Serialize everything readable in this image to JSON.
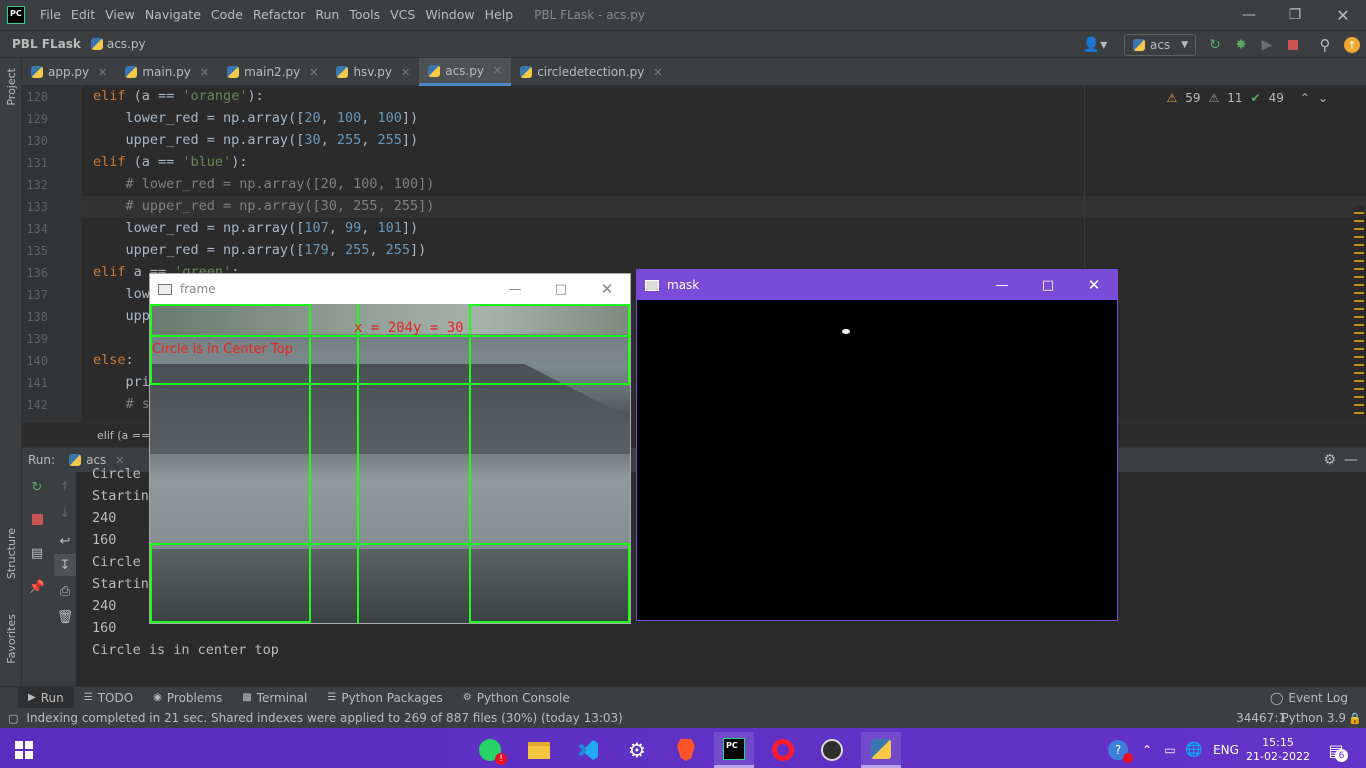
{
  "ide": {
    "menu": [
      "File",
      "Edit",
      "View",
      "Navigate",
      "Code",
      "Refactor",
      "Run",
      "Tools",
      "VCS",
      "Window",
      "Help"
    ],
    "window_title": "PBL FLask - acs.py",
    "project": "PBL FLask",
    "current_file": "acs.py",
    "run_config": "acs",
    "tabs": [
      {
        "label": "app.py"
      },
      {
        "label": "main.py"
      },
      {
        "label": "main2.py"
      },
      {
        "label": "hsv.py"
      },
      {
        "label": "acs.py",
        "active": true
      },
      {
        "label": "circledetection.py"
      }
    ],
    "inspections": {
      "warnings": "59",
      "weak_warnings": "11",
      "ok": "49"
    },
    "left_strip": {
      "project": "Project",
      "structure": "Structure",
      "favorites": "Favorites"
    },
    "code_lines": [
      {
        "n": "128",
        "text": "elif (a == 'orange'):"
      },
      {
        "n": "129",
        "text": "    lower_red = np.array([20, 100, 100])"
      },
      {
        "n": "130",
        "text": "    upper_red = np.array([30, 255, 255])"
      },
      {
        "n": "131",
        "text": "elif (a == 'blue'):"
      },
      {
        "n": "132",
        "text": "    # lower_red = np.array([20, 100, 100])"
      },
      {
        "n": "133",
        "text": "    # upper_red = np.array([30, 255, 255])"
      },
      {
        "n": "134",
        "text": "    lower_red = np.array([107, 99, 101])"
      },
      {
        "n": "135",
        "text": "    upper_red = np.array([179, 255, 255])"
      },
      {
        "n": "136",
        "text": "elif a == 'green':"
      },
      {
        "n": "137",
        "text": "    lower_red"
      },
      {
        "n": "138",
        "text": "    upper_red"
      },
      {
        "n": "139",
        "text": ""
      },
      {
        "n": "140",
        "text": "else:"
      },
      {
        "n": "141",
        "text": "    print"
      },
      {
        "n": "142",
        "text": "    # s"
      }
    ],
    "breadcrumb": "elif (a ==",
    "run_label": "Run:",
    "run_tab": "acs",
    "console_lines": [
      "Circle",
      "Startin",
      "240",
      "160",
      "Circle",
      "Startin",
      "240",
      "160",
      "Circle is in center top"
    ],
    "toolwindows": [
      "Run",
      "TODO",
      "Problems",
      "Terminal",
      "Python Packages",
      "Python Console"
    ],
    "event_log": "Event Log",
    "status": {
      "message": "Indexing completed in 21 sec. Shared indexes were applied to 269 of 887 files (30%) (today 13:03)",
      "position": "34467:1",
      "interpreter": "Python 3.9"
    }
  },
  "frame_window": {
    "title": "frame",
    "coords_text": "x = 204y = 30",
    "status_text": "Circle is in Center Top"
  },
  "mask_window": {
    "title": "mask"
  },
  "taskbar": {
    "lang": "ENG",
    "time": "15:15",
    "date": "21-02-2022",
    "notif_count": "6"
  },
  "colors": {
    "accent": "#4a88c7",
    "taskbar": "#5c2ec2",
    "grid": "#1aff1a",
    "mask_title": "#7a4bd6"
  }
}
